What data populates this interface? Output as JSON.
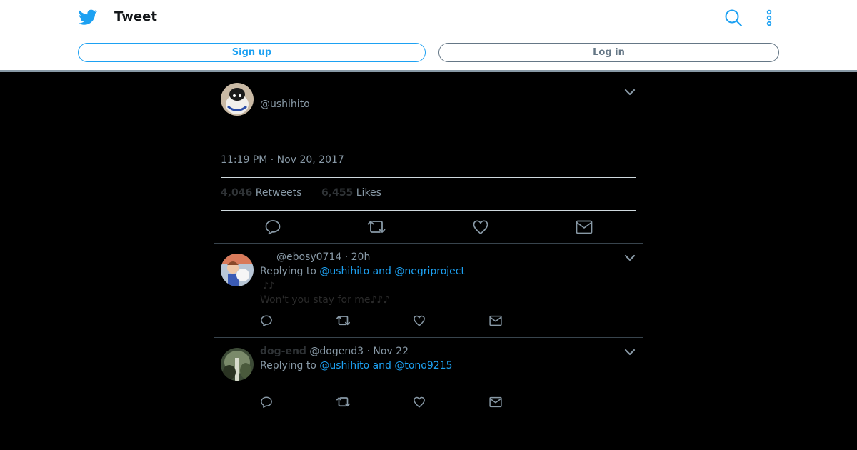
{
  "header": {
    "title": "Tweet",
    "signup_label": "Sign up",
    "login_label": "Log in",
    "logo_icon": "twitter-bird-icon",
    "search_icon": "search-icon",
    "more_icon": "more-vertical-icon"
  },
  "colors": {
    "brand_blue": "#1da1f2",
    "muted": "#8899a6",
    "background": "#000000"
  },
  "main_tweet": {
    "handle": "@ushihito",
    "timestamp": "11:19 PM · Nov 20, 2017",
    "retweets_count": "4,046",
    "retweets_label": "Retweets",
    "likes_count": "6,455",
    "likes_label": "Likes",
    "actions": [
      "reply-icon",
      "retweet-icon",
      "like-icon",
      "message-icon"
    ]
  },
  "replies": [
    {
      "display_name": "",
      "handle_time": "@ebosy0714 · 20h",
      "replying_prefix": "Replying to",
      "replying_to": "@ushihito and @negriproject",
      "text_line1": "♪♪",
      "text_line2": "Won't you stay for me♪♪♪"
    },
    {
      "display_name": "dog-end",
      "handle_time": "@dogend3 · Nov 22",
      "replying_prefix": "Replying to",
      "replying_to": "@ushihito and @tono9215",
      "text_line1": "",
      "text_line2": ""
    }
  ]
}
